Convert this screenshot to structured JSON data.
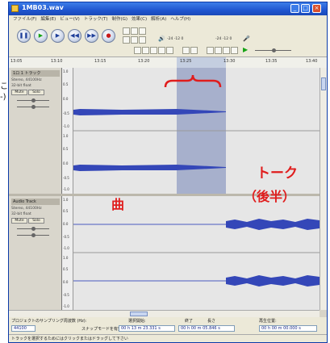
{
  "window": {
    "title": "1MB03.wav",
    "menu": [
      "ファイル(F)",
      "編集(E)",
      "ビュー(V)",
      "トラック(T)",
      "制作(G)",
      "効果(C)",
      "解析(A)",
      "ヘルプ(H)"
    ]
  },
  "ruler": {
    "ticks": [
      "13:05",
      "13:10",
      "13:15",
      "13:20",
      "13:25",
      "13:30",
      "13:35",
      "13:40"
    ]
  },
  "tracks": [
    {
      "name": "1ロ 1 トラック",
      "rate": "Stereo, 44100Hz",
      "format": "32-bit float",
      "mute": "Mute",
      "solo": "Solo",
      "scale": [
        "1.0",
        "0.5",
        "0.0",
        "-0.5",
        "-1.0",
        "1.0",
        "0.5",
        "0.0",
        "-0.5",
        "-1.0"
      ]
    },
    {
      "name": "Audio Track",
      "rate": "Stereo, 44100Hz",
      "format": "32-bit float",
      "mute": "Mute",
      "solo": "Solo",
      "scale": [
        "1.0",
        "0.5",
        "0.0",
        "-0.5",
        "-1.0",
        "1.0",
        "0.5",
        "0.0",
        "-0.5",
        "-1.0"
      ]
    }
  ],
  "toolbar": {
    "meter_l": "-24 -12 0",
    "meter_r": "-24 -12 0"
  },
  "bottom": {
    "project_rate_label": "プロジェクトのサンプリング周波数 (Hz):",
    "project_rate_value": "44100",
    "selection_start_label": "選択開始:",
    "snap_label": "スナップモードを有効",
    "start_value": "00 h 13 m 23.331 s",
    "end_label": "終了",
    "length_label": "長さ",
    "end_value": "00 h 00 m 05.846 s",
    "audio_pos_label": "再生位置:",
    "audio_pos_value": "00 h 00 m 00.000 s"
  },
  "status_bar": "トラックを選択するためにはクリックまたはドラッグして下さい",
  "annotations": {
    "left_partial": "こ\n-)",
    "song_label": "曲",
    "talk_label": "トーク",
    "talk_sub": "（後半）"
  },
  "colors": {
    "waveform": "#3447b8",
    "selection": "#a7b0cc",
    "annotation": "#e01d1d"
  }
}
